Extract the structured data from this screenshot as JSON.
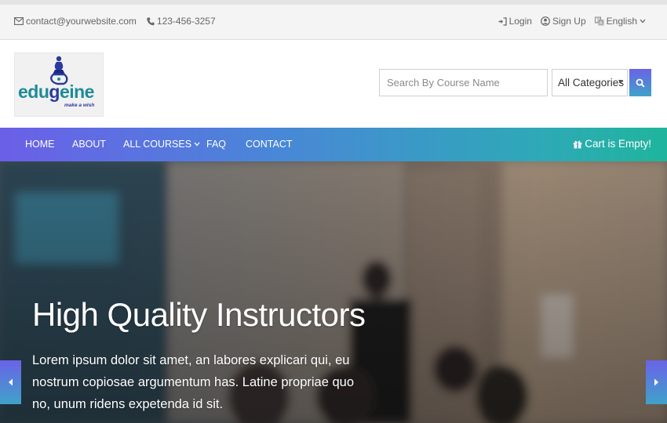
{
  "topbar": {
    "email": "contact@yourwebsite.com",
    "phone": "123-456-3257",
    "login": "Login",
    "signup": "Sign Up",
    "language": "English"
  },
  "logo": {
    "word_part1": "edu",
    "word_part2": "g",
    "word_part3": "eine",
    "tagline": "make a wish"
  },
  "search": {
    "placeholder": "Search By Course Name",
    "category_selected": "All Categories"
  },
  "nav": {
    "items": [
      "HOME",
      "ABOUT",
      "ALL COURSES",
      "FAQ",
      "CONTACT"
    ],
    "cart": "Cart is Empty!"
  },
  "hero": {
    "title": "High Quality Instructors",
    "text": "Lorem ipsum dolor sit amet, an labores explicari qui, eu nostrum copiosae argumentum has. Latine propriae quo no, unum ridens expetenda id sit."
  },
  "colors": {
    "accent_start": "#6b5fe8",
    "accent_end": "#1fb59d",
    "text_muted": "#666666"
  },
  "icons": {
    "email": "envelope-icon",
    "phone": "phone-icon",
    "login": "sign-in-icon",
    "signup": "user-circle-icon",
    "language": "language-icon",
    "search": "search-icon",
    "cart": "gift-icon"
  }
}
